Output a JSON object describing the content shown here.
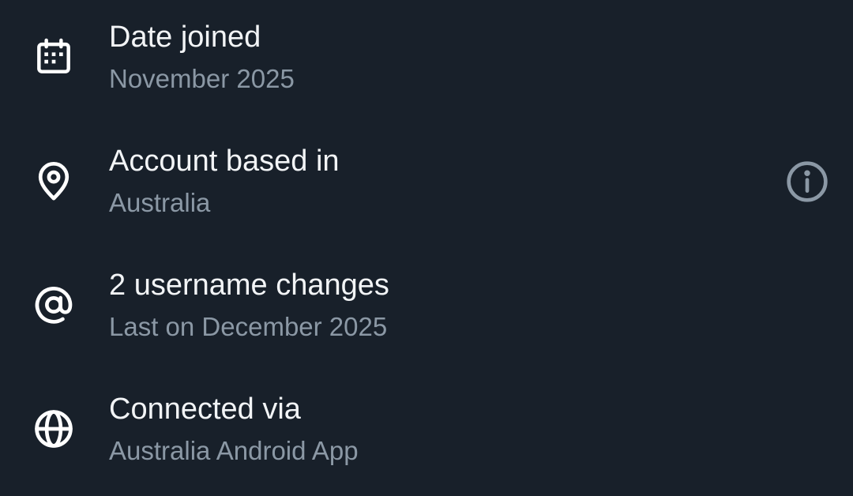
{
  "items": [
    {
      "icon": "calendar-icon",
      "title": "Date joined",
      "subtitle": "November 2025"
    },
    {
      "icon": "location-pin-icon",
      "title": "Account based in",
      "subtitle": "Australia",
      "action_icon": "info-icon"
    },
    {
      "icon": "at-sign-icon",
      "title": "2 username changes",
      "subtitle": "Last on December 2025"
    },
    {
      "icon": "globe-icon",
      "title": "Connected via",
      "subtitle": "Australia Android App"
    }
  ],
  "colors": {
    "background": "#18202a",
    "primary_text": "#f2f4f6",
    "secondary_text": "#8b98a5",
    "icon": "#ffffff",
    "info_icon": "#8b98a5"
  }
}
